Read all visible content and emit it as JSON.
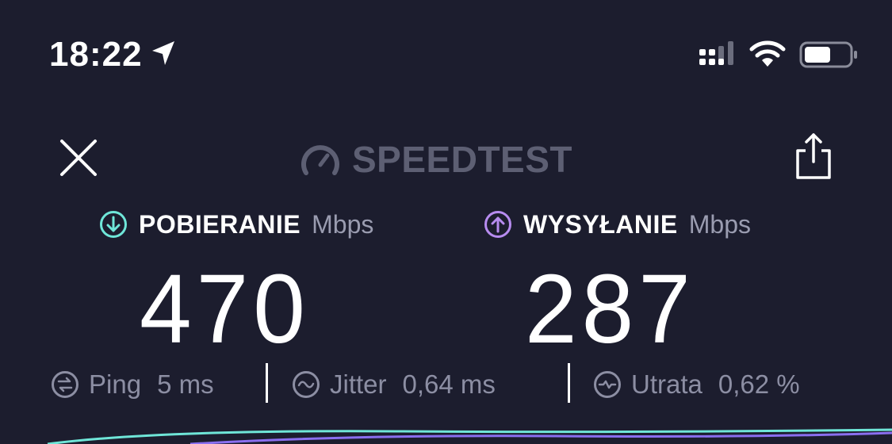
{
  "status_bar": {
    "time": "18:22"
  },
  "header": {
    "logo_text": "SPEEDTEST"
  },
  "download": {
    "label": "POBIERANIE",
    "unit": "Mbps",
    "value": "470",
    "color": "#6fe6d8"
  },
  "upload": {
    "label": "WYSYŁANIE",
    "unit": "Mbps",
    "value": "287",
    "color": "#b78cf0"
  },
  "stats": {
    "ping": {
      "label": "Ping",
      "value": "5 ms"
    },
    "jitter": {
      "label": "Jitter",
      "value": "0,64 ms"
    },
    "loss": {
      "label": "Utrata",
      "value": "0,62 %"
    }
  },
  "icons": {
    "location": "location-arrow-icon",
    "signal": "cellular-signal-icon",
    "wifi": "wifi-icon",
    "battery": "battery-icon",
    "close": "close-icon",
    "share": "share-icon",
    "gauge": "speedometer-icon",
    "download": "download-arrow-icon",
    "upload": "upload-arrow-icon",
    "ping": "ping-icon",
    "jitter": "jitter-icon",
    "loss": "packet-loss-icon"
  }
}
